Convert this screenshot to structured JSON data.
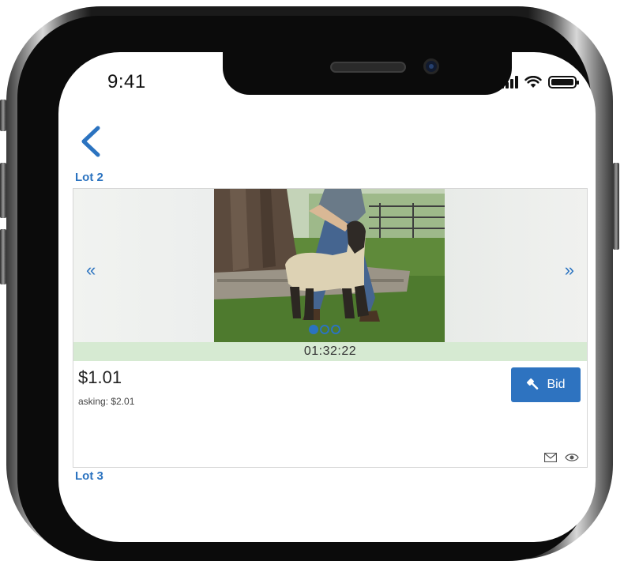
{
  "status_bar": {
    "time": "9:41"
  },
  "lot": {
    "label": "Lot 2",
    "timer": "01:32:22",
    "price": "$1.01",
    "asking": "asking: $2.01",
    "bid_label": "Bid",
    "image_count": 3,
    "active_image": 1
  },
  "next_lot": {
    "label": "Lot 3"
  },
  "icons": {
    "back": "chevron-left-icon",
    "prev": "double-chevron-left-icon",
    "next": "double-chevron-right-icon",
    "bid": "gavel-icon",
    "mail": "mail-icon",
    "watch": "eye-icon"
  },
  "colors": {
    "accent": "#2b73c0",
    "timer_bg": "#d6ead2",
    "button": "#2e73c0"
  }
}
